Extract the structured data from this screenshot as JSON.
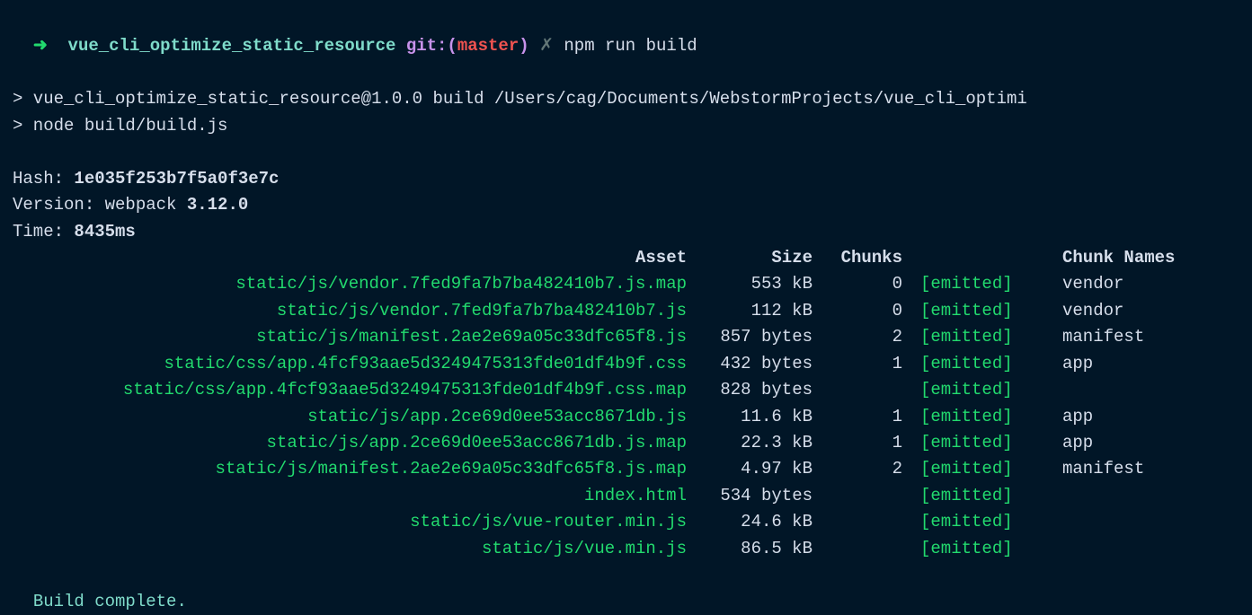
{
  "prompt": {
    "arrow": "➜",
    "dir": "vue_cli_optimize_static_resource",
    "git_label": "git:(",
    "branch": "master",
    "git_close": ")",
    "dirty": "✗",
    "command": "npm run build"
  },
  "npm": {
    "line1": "> vue_cli_optimize_static_resource@1.0.0 build /Users/cag/Documents/WebstormProjects/vue_cli_optimi",
    "line2": "> node build/build.js"
  },
  "webpack": {
    "hash_label": "Hash: ",
    "hash": "1e035f253b7f5a0f3e7c",
    "version_label": "Version: ",
    "version_prefix": "webpack ",
    "version": "3.12.0",
    "time_label": "Time: ",
    "time": "8435ms"
  },
  "headers": {
    "asset": "Asset",
    "size": "Size",
    "chunks": "Chunks",
    "names": "Chunk Names"
  },
  "emitted": "[emitted]",
  "assets": [
    {
      "asset": "static/js/vendor.7fed9fa7b7ba482410b7.js.map",
      "size": "553 kB",
      "chunks": "0",
      "name": "vendor"
    },
    {
      "asset": "static/js/vendor.7fed9fa7b7ba482410b7.js",
      "size": "112 kB",
      "chunks": "0",
      "name": "vendor"
    },
    {
      "asset": "static/js/manifest.2ae2e69a05c33dfc65f8.js",
      "size": "857 bytes",
      "chunks": "2",
      "name": "manifest"
    },
    {
      "asset": "static/css/app.4fcf93aae5d3249475313fde01df4b9f.css",
      "size": "432 bytes",
      "chunks": "1",
      "name": "app"
    },
    {
      "asset": "static/css/app.4fcf93aae5d3249475313fde01df4b9f.css.map",
      "size": "828 bytes",
      "chunks": "",
      "name": ""
    },
    {
      "asset": "static/js/app.2ce69d0ee53acc8671db.js",
      "size": "11.6 kB",
      "chunks": "1",
      "name": "app"
    },
    {
      "asset": "static/js/app.2ce69d0ee53acc8671db.js.map",
      "size": "22.3 kB",
      "chunks": "1",
      "name": "app"
    },
    {
      "asset": "static/js/manifest.2ae2e69a05c33dfc65f8.js.map",
      "size": "4.97 kB",
      "chunks": "2",
      "name": "manifest"
    },
    {
      "asset": "index.html",
      "size": "534 bytes",
      "chunks": "",
      "name": ""
    },
    {
      "asset": "static/js/vue-router.min.js",
      "size": "24.6 kB",
      "chunks": "",
      "name": ""
    },
    {
      "asset": "static/js/vue.min.js",
      "size": "86.5 kB",
      "chunks": "",
      "name": ""
    }
  ],
  "complete": "Build complete."
}
